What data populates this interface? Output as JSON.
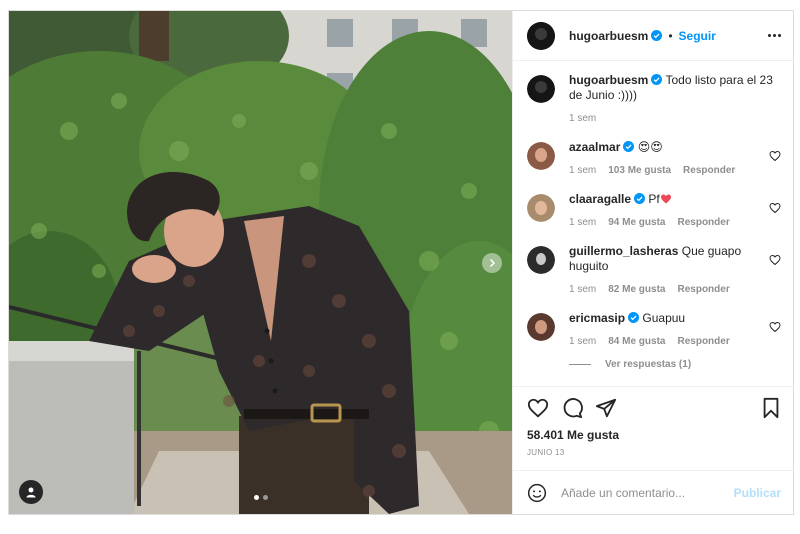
{
  "post": {
    "author": "hugoarbuesm",
    "follow_label": "Seguir",
    "separator": "•",
    "caption": {
      "username": "hugoarbuesm",
      "text": "Todo listo para el 23 de Junio :))))",
      "time": "1 sem"
    },
    "comments": [
      {
        "username": "azaalmar",
        "verified": true,
        "text": "😍😍",
        "time": "1 sem",
        "likes": "103 Me gusta",
        "reply": "Responder"
      },
      {
        "username": "claaragalle",
        "verified": true,
        "text": "Pf",
        "time": "1 sem",
        "likes": "94 Me gusta",
        "reply": "Responder"
      },
      {
        "username": "guillermo_lasheras",
        "verified": false,
        "text": "Que guapo huguito",
        "time": "1 sem",
        "likes": "82 Me gusta",
        "reply": "Responder"
      },
      {
        "username": "ericmasip",
        "verified": true,
        "text": "Guapuu",
        "time": "1 sem",
        "likes": "84 Me gusta",
        "reply": "Responder"
      }
    ],
    "view_replies": "Ver respuestas (1)",
    "likes": "58.401 Me gusta",
    "date": "JUNIO 13",
    "carousel": {
      "total": 2,
      "current": 1
    }
  },
  "composer": {
    "placeholder": "Añade un comentario...",
    "publish_label": "Publicar"
  },
  "icons": [
    "more-options-icon",
    "verified-badge-icon",
    "heart-icon",
    "comment-icon",
    "share-icon",
    "bookmark-icon",
    "emoji-icon",
    "tag-user-icon",
    "next-arrow-icon"
  ],
  "colors": {
    "accent": "#0095f6",
    "publish_disabled": "#b2dffc",
    "heart_red": "#ed4956",
    "verified": "#0095f6"
  }
}
